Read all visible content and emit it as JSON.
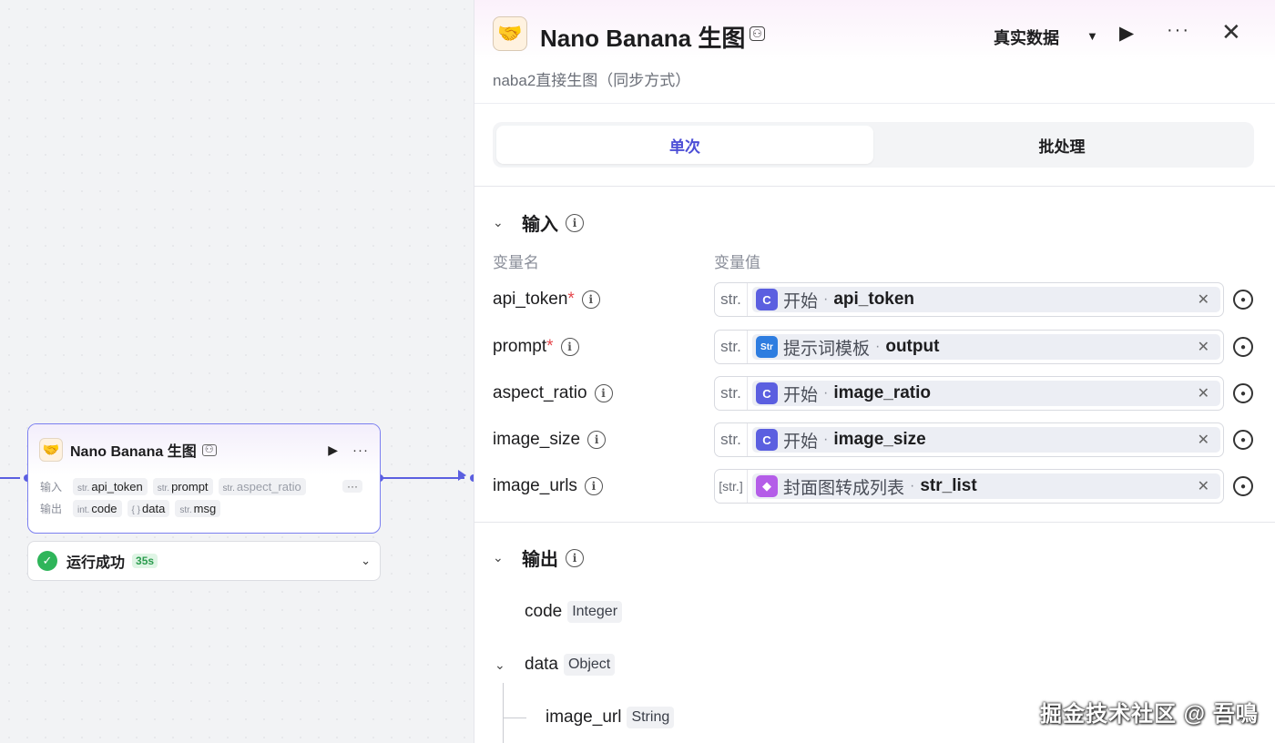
{
  "node": {
    "title": "Nano Banana 生图",
    "input_label": "输入",
    "output_label": "输出",
    "inputs": [
      {
        "type": "str.",
        "name": "api_token"
      },
      {
        "type": "str.",
        "name": "prompt"
      },
      {
        "type": "str.",
        "name": "aspect_ratio"
      }
    ],
    "more_label": "···",
    "outputs": [
      {
        "type": "int.",
        "name": "code"
      },
      {
        "type": "{ }",
        "name": "data"
      },
      {
        "type": "str.",
        "name": "msg"
      }
    ]
  },
  "status": {
    "text": "运行成功",
    "duration": "35s"
  },
  "panel": {
    "title": "Nano Banana 生图",
    "description": "naba2直接生图（同步方式）",
    "data_mode": "真实数据",
    "tabs": [
      {
        "label": "单次",
        "active": true
      },
      {
        "label": "批处理",
        "active": false
      }
    ],
    "input_section": {
      "title": "输入",
      "col_name": "变量名",
      "col_value": "变量值",
      "rows": [
        {
          "name": "api_token",
          "required": "*",
          "type": "str.",
          "icon": "start-node-icon",
          "source": "开始",
          "var": "api_token"
        },
        {
          "name": "prompt",
          "required": "*",
          "type": "str.",
          "icon": "prompt-template-icon",
          "source": "提示词模板",
          "var": "output"
        },
        {
          "name": "aspect_ratio",
          "required": "",
          "type": "str.",
          "icon": "start-node-icon",
          "source": "开始",
          "var": "image_ratio"
        },
        {
          "name": "image_size",
          "required": "",
          "type": "str.",
          "icon": "start-node-icon",
          "source": "开始",
          "var": "image_size"
        },
        {
          "name": "image_urls",
          "required": "",
          "type": "[str.]",
          "icon": "list-convert-icon",
          "source": "封面图转成列表",
          "var": "str_list"
        }
      ]
    },
    "output_section": {
      "title": "输出",
      "fields": [
        {
          "name": "code",
          "type": "Integer"
        },
        {
          "name": "data",
          "type": "Object"
        },
        {
          "name": "image_url",
          "type": "String"
        }
      ]
    }
  },
  "watermark": "掘金技术社区 @ 吾鳴",
  "colors": {
    "accent": "#5b5fe0",
    "success": "#2fb55a",
    "required": "#e5484d",
    "list_icon": "#b45de8",
    "template_icon": "#2e7de0"
  }
}
